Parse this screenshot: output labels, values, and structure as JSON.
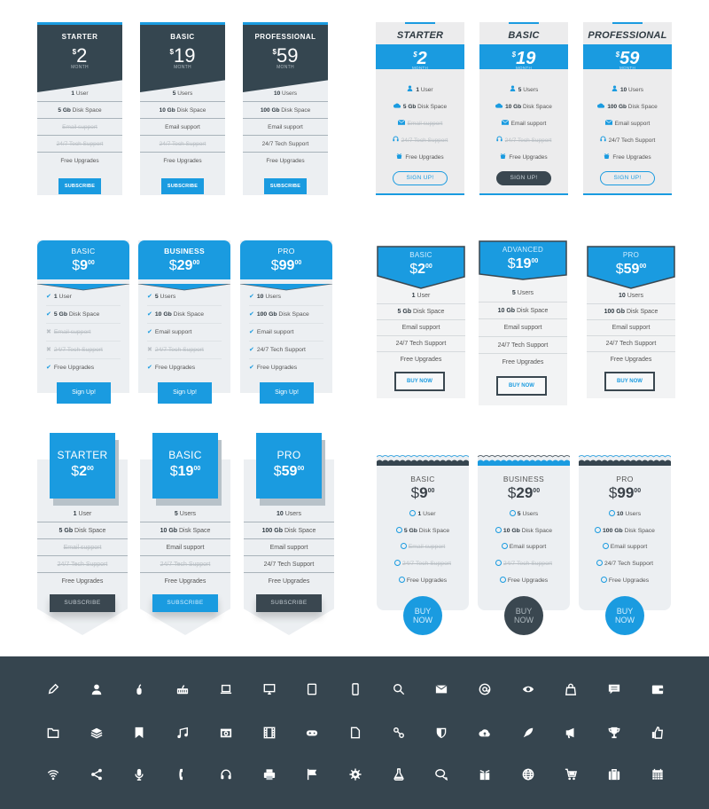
{
  "set1": {
    "style": "dark-header-diagonal",
    "month_label": "MONTH",
    "plans": [
      {
        "name": "STARTER",
        "currency": "$",
        "price": "2",
        "features": [
          {
            "bold": "1",
            "text": " User",
            "enabled": true
          },
          {
            "bold": "5 Gb",
            "text": " Disk Space",
            "enabled": true
          },
          {
            "bold": "",
            "text": "Email support",
            "enabled": false
          },
          {
            "bold": "",
            "text": "24/7 Tech Support",
            "enabled": false
          },
          {
            "bold": "",
            "text": "Free Upgrades",
            "enabled": true
          }
        ],
        "button": "SUBSCRIBE"
      },
      {
        "name": "BASIC",
        "currency": "$",
        "price": "19",
        "features": [
          {
            "bold": "5",
            "text": " Users",
            "enabled": true
          },
          {
            "bold": "10 Gb",
            "text": " Disk Space",
            "enabled": true
          },
          {
            "bold": "",
            "text": "Email support",
            "enabled": true
          },
          {
            "bold": "",
            "text": "24/7 Tech Support",
            "enabled": false
          },
          {
            "bold": "",
            "text": "Free Upgrades",
            "enabled": true
          }
        ],
        "button": "SUBSCRIBE"
      },
      {
        "name": "PROFESSIONAL",
        "currency": "$",
        "price": "59",
        "features": [
          {
            "bold": "10",
            "text": " Users",
            "enabled": true
          },
          {
            "bold": "100 Gb",
            "text": " Disk Space",
            "enabled": true
          },
          {
            "bold": "",
            "text": "Email support",
            "enabled": true
          },
          {
            "bold": "",
            "text": "24/7 Tech Support",
            "enabled": true
          },
          {
            "bold": "",
            "text": "Free Upgrades",
            "enabled": true
          }
        ],
        "button": "SUBSCRIBE"
      }
    ]
  },
  "set2": {
    "style": "italic-blue-band",
    "month_label": "MONTH",
    "feature_icons": [
      "user-icon",
      "cloud-icon",
      "envelope-icon",
      "headset-icon",
      "gift-icon"
    ],
    "plans": [
      {
        "name": "STARTER",
        "currency": "$",
        "price": "2",
        "features": [
          {
            "bold": "1",
            "text": " User",
            "enabled": true
          },
          {
            "bold": "5 Gb",
            "text": " Disk Space",
            "enabled": true
          },
          {
            "bold": "",
            "text": "Email support",
            "enabled": false
          },
          {
            "bold": "",
            "text": "24/7 Tech Support",
            "enabled": false
          },
          {
            "bold": "",
            "text": "Free Upgrades",
            "enabled": true
          }
        ],
        "button": "SIGN UP!",
        "highlighted": false
      },
      {
        "name": "BASIC",
        "currency": "$",
        "price": "19",
        "features": [
          {
            "bold": "5",
            "text": " Users",
            "enabled": true
          },
          {
            "bold": "10 Gb",
            "text": " Disk Space",
            "enabled": true
          },
          {
            "bold": "",
            "text": "Email support",
            "enabled": true
          },
          {
            "bold": "",
            "text": "24/7 Tech Support",
            "enabled": false
          },
          {
            "bold": "",
            "text": "Free Upgrades",
            "enabled": true
          }
        ],
        "button": "SIGN UP!",
        "highlighted": true
      },
      {
        "name": "PROFESSIONAL",
        "currency": "$",
        "price": "59",
        "features": [
          {
            "bold": "10",
            "text": " Users",
            "enabled": true
          },
          {
            "bold": "100 Gb",
            "text": " Disk Space",
            "enabled": true
          },
          {
            "bold": "",
            "text": "Email support",
            "enabled": true
          },
          {
            "bold": "",
            "text": "24/7 Tech Support",
            "enabled": true
          },
          {
            "bold": "",
            "text": "Free Upgrades",
            "enabled": true
          }
        ],
        "button": "SIGN UP!",
        "highlighted": false
      }
    ]
  },
  "set3": {
    "style": "rounded-blue-chevron",
    "plans": [
      {
        "name": "BASIC",
        "currency": "$",
        "price": "9",
        "cents": "00",
        "features": [
          {
            "bold": "1",
            "text": " User",
            "enabled": true
          },
          {
            "bold": "5 Gb",
            "text": " Disk Space",
            "enabled": true
          },
          {
            "bold": "",
            "text": "Email support",
            "enabled": false
          },
          {
            "bold": "",
            "text": "24/7 Tech Support",
            "enabled": false
          },
          {
            "bold": "",
            "text": "Free Upgrades",
            "enabled": true
          }
        ],
        "button": "Sign Up!",
        "highlighted": false
      },
      {
        "name": "BUSINESS",
        "currency": "$",
        "price": "29",
        "cents": "00",
        "features": [
          {
            "bold": "5",
            "text": " Users",
            "enabled": true
          },
          {
            "bold": "10 Gb",
            "text": " Disk Space",
            "enabled": true
          },
          {
            "bold": "",
            "text": "Email support",
            "enabled": true
          },
          {
            "bold": "",
            "text": "24/7 Tech Support",
            "enabled": false
          },
          {
            "bold": "",
            "text": "Free Upgrades",
            "enabled": true
          }
        ],
        "button": "Sign Up!",
        "highlighted": true
      },
      {
        "name": "PRO",
        "currency": "$",
        "price": "99",
        "cents": "00",
        "features": [
          {
            "bold": "10",
            "text": " Users",
            "enabled": true
          },
          {
            "bold": "100 Gb",
            "text": " Disk Space",
            "enabled": true
          },
          {
            "bold": "",
            "text": "Email support",
            "enabled": true
          },
          {
            "bold": "",
            "text": "24/7 Tech Support",
            "enabled": true
          },
          {
            "bold": "",
            "text": "Free Upgrades",
            "enabled": true
          }
        ],
        "button": "Sign Up!",
        "highlighted": false
      }
    ]
  },
  "set4": {
    "style": "ribbon-banner",
    "plans": [
      {
        "name": "BASIC",
        "currency": "$",
        "price": "2",
        "cents": "00",
        "features": [
          {
            "bold": "1",
            "text": " User",
            "enabled": true
          },
          {
            "bold": "5 Gb",
            "text": " Disk Space",
            "enabled": true
          },
          {
            "bold": "",
            "text": "Email support",
            "enabled": true
          },
          {
            "bold": "",
            "text": "24/7 Tech Support",
            "enabled": true
          },
          {
            "bold": "",
            "text": "Free Upgrades",
            "enabled": true
          }
        ],
        "button": "BUY NOW",
        "highlighted": false
      },
      {
        "name": "ADVANCED",
        "currency": "$",
        "price": "19",
        "cents": "00",
        "features": [
          {
            "bold": "5",
            "text": " Users",
            "enabled": true
          },
          {
            "bold": "10 Gb",
            "text": " Disk Space",
            "enabled": true
          },
          {
            "bold": "",
            "text": "Email support",
            "enabled": true
          },
          {
            "bold": "",
            "text": "24/7 Tech Support",
            "enabled": true
          },
          {
            "bold": "",
            "text": "Free Upgrades",
            "enabled": true
          }
        ],
        "button": "BUY NOW",
        "highlighted": true
      },
      {
        "name": "PRO",
        "currency": "$",
        "price": "59",
        "cents": "00",
        "features": [
          {
            "bold": "10",
            "text": " Users",
            "enabled": true
          },
          {
            "bold": "100 Gb",
            "text": " Disk Space",
            "enabled": true
          },
          {
            "bold": "",
            "text": "Email support",
            "enabled": true
          },
          {
            "bold": "",
            "text": "24/7 Tech Support",
            "enabled": true
          },
          {
            "bold": "",
            "text": "Free Upgrades",
            "enabled": true
          }
        ],
        "button": "BUY NOW",
        "highlighted": false
      }
    ]
  },
  "set5": {
    "style": "square-header-shadow",
    "plans": [
      {
        "name": "STARTER",
        "currency": "$",
        "price": "2",
        "cents": "00",
        "features": [
          {
            "bold": "1",
            "text": " User",
            "enabled": true
          },
          {
            "bold": "5 Gb",
            "text": " Disk Space",
            "enabled": true
          },
          {
            "bold": "",
            "text": "Email support",
            "enabled": false
          },
          {
            "bold": "",
            "text": "24/7 Tech Support",
            "enabled": false
          },
          {
            "bold": "",
            "text": "Free Upgrades",
            "enabled": true
          }
        ],
        "button": "SUBSCRIBE",
        "highlighted": false
      },
      {
        "name": "BASIC",
        "currency": "$",
        "price": "19",
        "cents": "00",
        "features": [
          {
            "bold": "5",
            "text": " Users",
            "enabled": true
          },
          {
            "bold": "10 Gb",
            "text": " Disk Space",
            "enabled": true
          },
          {
            "bold": "",
            "text": "Email support",
            "enabled": true
          },
          {
            "bold": "",
            "text": "24/7 Tech Support",
            "enabled": false
          },
          {
            "bold": "",
            "text": "Free Upgrades",
            "enabled": true
          }
        ],
        "button": "SUBSCRIBE",
        "highlighted": true
      },
      {
        "name": "PRO",
        "currency": "$",
        "price": "59",
        "cents": "00",
        "features": [
          {
            "bold": "10",
            "text": " Users",
            "enabled": true
          },
          {
            "bold": "100 Gb",
            "text": " Disk Space",
            "enabled": true
          },
          {
            "bold": "",
            "text": "Email support",
            "enabled": true
          },
          {
            "bold": "",
            "text": "24/7 Tech Support",
            "enabled": true
          },
          {
            "bold": "",
            "text": "Free Upgrades",
            "enabled": true
          }
        ],
        "button": "SUBSCRIBE",
        "highlighted": false
      }
    ]
  },
  "set6": {
    "style": "wavy-top-round-button",
    "plans": [
      {
        "name": "BASIC",
        "currency": "$",
        "price": "9",
        "cents": "00",
        "features": [
          {
            "bold": "1",
            "text": " User",
            "enabled": true
          },
          {
            "bold": "5 Gb",
            "text": " Disk Space",
            "enabled": true
          },
          {
            "bold": "",
            "text": "Email support",
            "enabled": false
          },
          {
            "bold": "",
            "text": "24/7 Tech Support",
            "enabled": false
          },
          {
            "bold": "",
            "text": "Free Upgrades",
            "enabled": true
          }
        ],
        "button": "BUY NOW",
        "highlighted": false
      },
      {
        "name": "BUSINESS",
        "currency": "$",
        "price": "29",
        "cents": "00",
        "features": [
          {
            "bold": "5",
            "text": " Users",
            "enabled": true
          },
          {
            "bold": "10 Gb",
            "text": " Disk Space",
            "enabled": true
          },
          {
            "bold": "",
            "text": "Email support",
            "enabled": true
          },
          {
            "bold": "",
            "text": "24/7 Tech Support",
            "enabled": false
          },
          {
            "bold": "",
            "text": "Free Upgrades",
            "enabled": true
          }
        ],
        "button": "BUY NOW",
        "highlighted": true
      },
      {
        "name": "PRO",
        "currency": "$",
        "price": "99",
        "cents": "00",
        "features": [
          {
            "bold": "10",
            "text": " Users",
            "enabled": true
          },
          {
            "bold": "100 Gb",
            "text": " Disk Space",
            "enabled": true
          },
          {
            "bold": "",
            "text": "Email support",
            "enabled": true
          },
          {
            "bold": "",
            "text": "24/7 Tech Support",
            "enabled": true
          },
          {
            "bold": "",
            "text": "Free Upgrades",
            "enabled": true
          }
        ],
        "button": "BUY NOW",
        "highlighted": false
      }
    ]
  },
  "icons": [
    [
      "pencil-icon",
      "user-icon",
      "mouse-icon",
      "keyboard-icon",
      "laptop-icon",
      "monitor-icon",
      "tablet-icon",
      "phone-icon",
      "search-icon",
      "envelope-icon",
      "at-sign-icon",
      "eye-icon",
      "shopping-bag-icon",
      "chat-bubble-icon",
      "wallet-icon"
    ],
    [
      "folder-icon",
      "layers-icon",
      "bookmark-icon",
      "music-icon",
      "photo-icon",
      "film-icon",
      "gamepad-icon",
      "document-icon",
      "link-icon",
      "shield-icon",
      "cloud-upload-icon",
      "rocket-icon",
      "megaphone-icon",
      "trophy-icon",
      "thumbs-up-icon"
    ],
    [
      "wifi-icon",
      "share-icon",
      "microphone-icon",
      "telephone-icon",
      "headset-icon",
      "printer-icon",
      "flag-icon",
      "gear-icon",
      "flask-icon",
      "chat-bubbles-icon",
      "gift-box-icon",
      "globe-icon",
      "shopping-cart-icon",
      "briefcase-icon",
      "calendar-icon"
    ]
  ],
  "colors": {
    "accent": "#1a9be0",
    "dark": "#36454f",
    "card": "#eceff2",
    "muted": "#b9bfc4"
  }
}
